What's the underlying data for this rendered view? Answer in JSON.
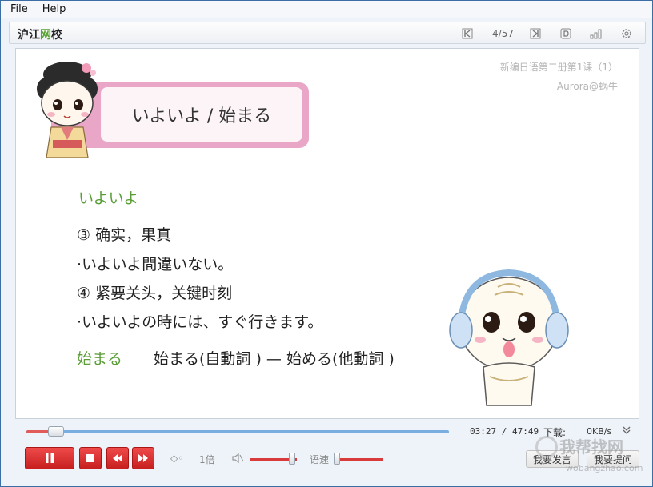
{
  "menu": {
    "file": "File",
    "help": "Help"
  },
  "toolbar": {
    "brand_prefix": "沪江",
    "brand_highlight": "网",
    "brand_suffix": "校",
    "page_indicator": "4/57"
  },
  "slide": {
    "course_title": "新编日语第二册第1课（1）",
    "author": "Aurora@蜗牛",
    "title": "いよいよ / 始まる",
    "lines": [
      "いよいよ",
      "③ 确实，果真",
      "·いよいよ間違いない。",
      "④ 紧要关头，关键时刻",
      "·いよいよの時には、すぐ行きます。"
    ],
    "last_line": {
      "word": "始まる",
      "text": "始まる(自動詞 ) — 始める(他動詞 )"
    }
  },
  "player": {
    "time": "03:27 / 47:49",
    "progress_fraction": 0.07,
    "download_label": "下载:",
    "download_speed": "0KB/s",
    "speed_label": "1倍",
    "rate_label": "语速",
    "speak_button": "我要发言",
    "ask_button": "我要提问"
  },
  "watermark": {
    "text": "我帮找网",
    "url": "wobangzhao.com"
  },
  "colors": {
    "accent_red": "#d93a3a",
    "green_text": "#5b9e37",
    "title_pink": "#e9a6c7"
  }
}
